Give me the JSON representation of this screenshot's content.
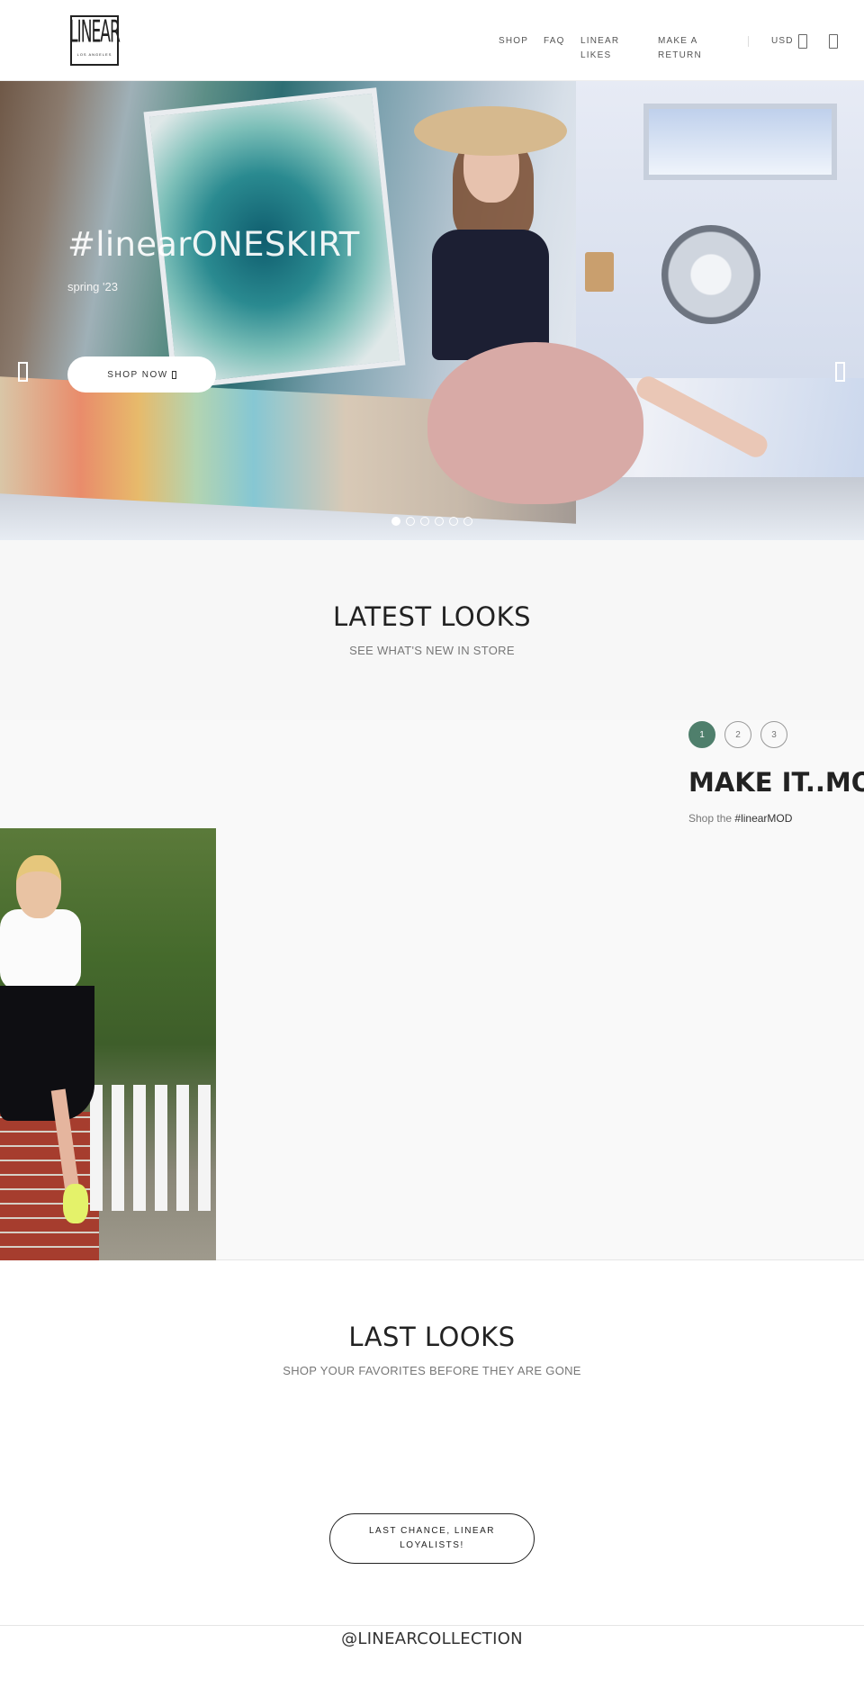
{
  "header": {
    "logo_text": "LINEAR",
    "logo_sub": "LOS ANGELES",
    "nav": [
      "SHOP",
      "FAQ",
      "LINEAR LIKES",
      "MAKE A RETURN"
    ],
    "currency": "USD",
    "icons": [
      "search-icon",
      "cart-icon"
    ]
  },
  "hero": {
    "title": "#linearONESKIRT",
    "subtitle": "spring '23",
    "button_label": "SHOP NOW",
    "slide_count": 6,
    "active_slide": 1,
    "icons": [
      "arrow-left-icon",
      "arrow-right-icon"
    ]
  },
  "latest": {
    "title": "LATEST LOOKS",
    "subtitle": "SEE WHAT'S NEW IN STORE"
  },
  "mod": {
    "pages": [
      "1",
      "2",
      "3"
    ],
    "active_page": "1",
    "accent": "#4f7f6c",
    "title": "MAKE IT..MOD",
    "subtitle_prefix": "Shop the",
    "subtitle_link": "#linearMOD"
  },
  "last": {
    "title": "LAST LOOKS",
    "subtitle": "SHOP YOUR FAVORITES BEFORE THEY ARE GONE",
    "button_label": "LAST CHANCE, LINEAR LOYALISTS!"
  },
  "footer": {
    "instagram": "@LINEARCOLLECTION"
  }
}
